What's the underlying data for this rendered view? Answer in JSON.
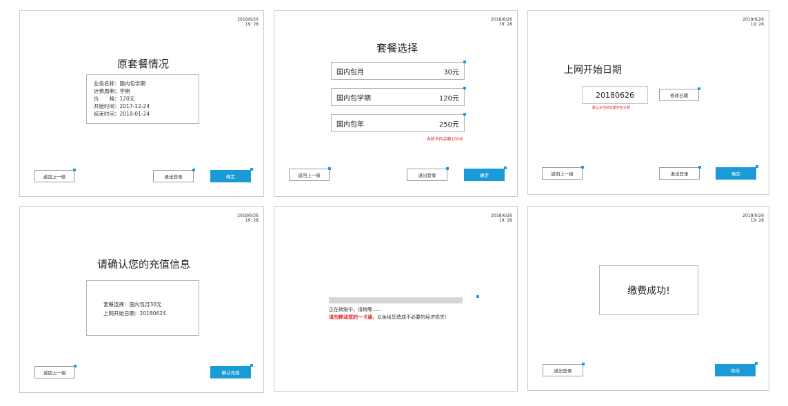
{
  "timestamps": [
    {
      "date": "2018/6/26",
      "time": "19: 28"
    },
    {
      "date": "2018/6/26",
      "time": "19: 28"
    },
    {
      "date": "2018/6/26",
      "time": "19: 28"
    },
    {
      "date": "2018/6/26",
      "time": "19: 28"
    },
    {
      "date": "2018/6/26",
      "time": "19: 28"
    },
    {
      "date": "2018/6/26",
      "time": "19: 28"
    }
  ],
  "common": {
    "back_label": "返回上一级",
    "logout_label": "退出登录",
    "ok_label": "确定"
  },
  "screen1": {
    "title": "原套餐情况",
    "info": [
      "业务名称：国内包学期",
      "计费周期：学期",
      "价　　格：120元",
      "开始时间：2017-12-24",
      "结束时间：2018-01-24"
    ]
  },
  "screen2": {
    "title": "套餐选择",
    "packages": [
      {
        "name": "国内包月",
        "price": "30元"
      },
      {
        "name": "国内包学期",
        "price": "120元"
      },
      {
        "name": "国内包年",
        "price": "250元"
      }
    ],
    "balance_note": "当前卡内余额100元"
  },
  "screen3": {
    "title": "上网开始日期",
    "date_value": "20180626",
    "modify_label": "修改日期",
    "note": "默认从当前日期开始计费"
  },
  "screen4": {
    "title": "请确认您的充值信息",
    "info": [
      "套餐选择：国内包月30元",
      "上网开始日期：20180624"
    ],
    "confirm_label": "确认充值"
  },
  "screen5": {
    "progress": 0.0,
    "status_text": "正在转账中，请稍等......",
    "warning_bold": "请勿移动您的一卡通",
    "warning_rest": "，以免给您造成不必要的经济损失!"
  },
  "screen6": {
    "message": "缴费成功!",
    "continue_label": "继续"
  },
  "colors": {
    "accent": "#1a9bd7",
    "warning": "#e02020"
  }
}
